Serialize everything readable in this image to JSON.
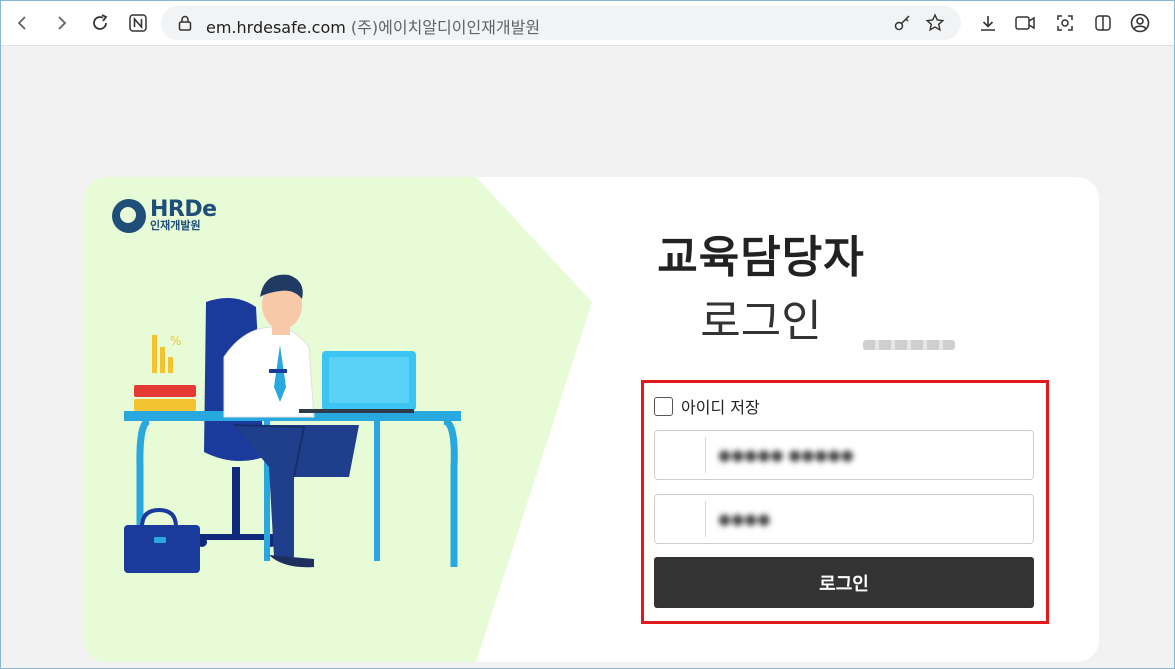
{
  "browser": {
    "url_domain": "em.hrdesafe.com",
    "site_name": "(주)에이치알디이인재개발원",
    "icons": [
      "back-icon",
      "forward-icon",
      "reload-icon",
      "naver-icon",
      "site-info-icon",
      "key-icon",
      "bookmark-star-icon",
      "download-icon",
      "media-icon",
      "screenshot-icon",
      "split-view-icon",
      "profile-icon"
    ]
  },
  "logo": {
    "brand": "HRDe",
    "sub": "인재개발원"
  },
  "login": {
    "title": "교육담당자",
    "subtitle": "로그인",
    "save_id_label": "아이디 저장",
    "id_value": "●●●●● ●●●●●",
    "password_value": "●●●●",
    "submit_label": "로그인"
  },
  "colors": {
    "panel_bg": "#e6fbd6",
    "button_bg": "#333333",
    "highlight": "#e01b1b",
    "desk": "#29a8e0",
    "chair": "#1a3a9c"
  }
}
